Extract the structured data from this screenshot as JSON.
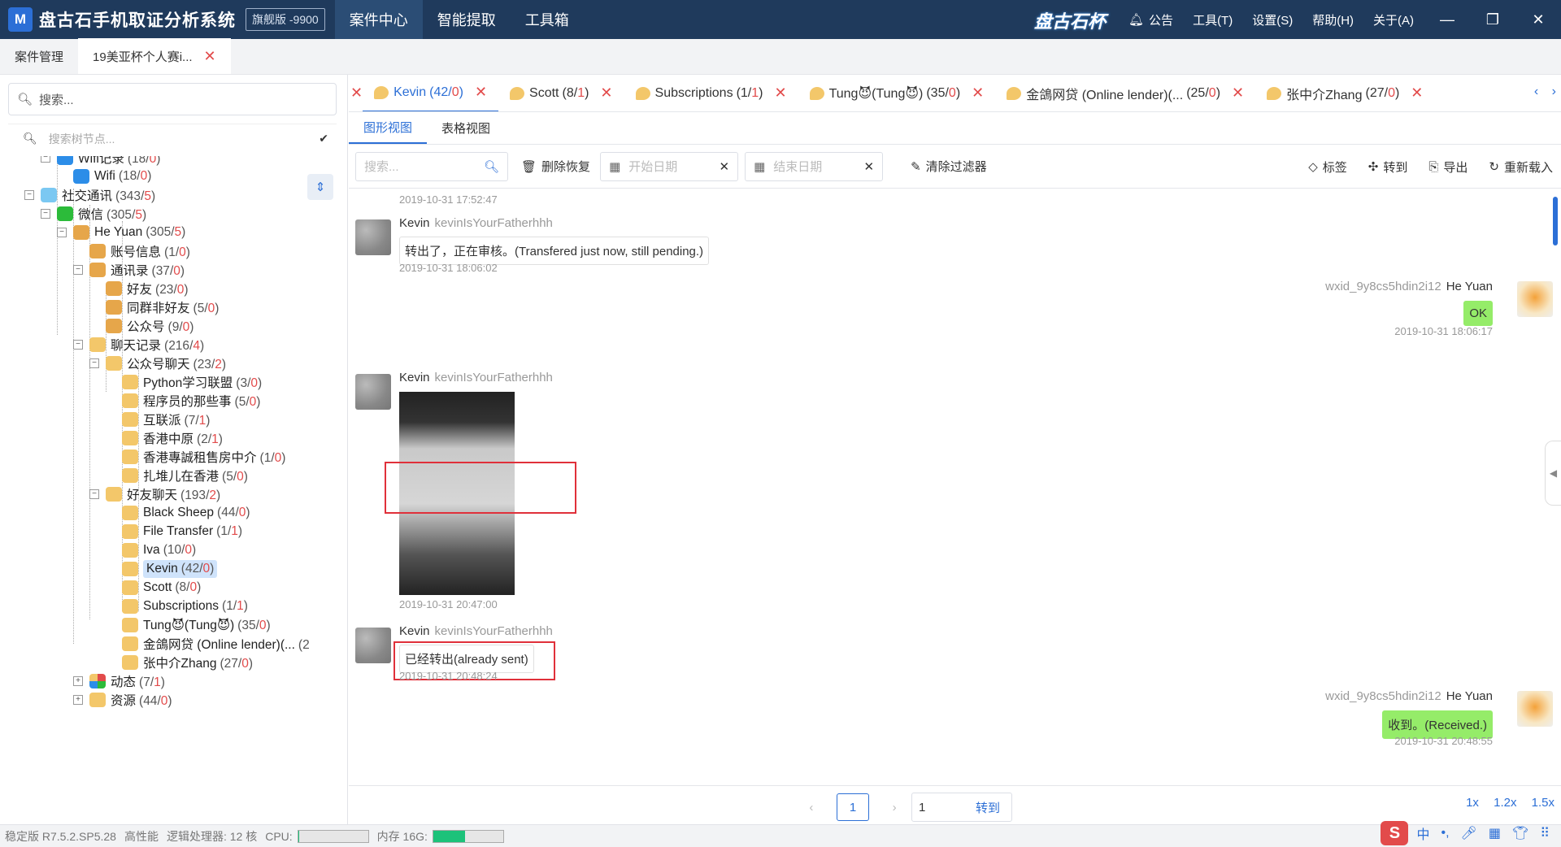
{
  "titlebar": {
    "logo": "M",
    "title": "盘古石手机取证分析系统",
    "edition": "旗舰版 -9900",
    "nav": [
      "案件中心",
      "智能提取",
      "工具箱"
    ],
    "brand": "盘古石杯",
    "menu": [
      "公告",
      "工具(T)",
      "设置(S)",
      "帮助(H)",
      "关于(A)"
    ]
  },
  "doctabs": [
    {
      "label": "案件管理"
    },
    {
      "label": "19美亚杯个人赛i..."
    }
  ],
  "left": {
    "search_placeholder": "搜索...",
    "tree_search_placeholder": "搜索树节点...",
    "tree": [
      {
        "label": "Wifi记录",
        "a": "18",
        "b": "0",
        "icon": "wifi-icon"
      },
      {
        "label": "Wifi",
        "a": "18",
        "b": "0",
        "icon": "wifi-icon"
      },
      {
        "label": "社交通讯",
        "a": "343",
        "b": "5",
        "icon": "social-icon"
      },
      {
        "label": "微信",
        "a": "305",
        "b": "5",
        "icon": "wechat-icon"
      },
      {
        "label": "He Yuan",
        "a": "305",
        "b": "5",
        "icon": "user-icon"
      },
      {
        "label": "账号信息",
        "a": "1",
        "b": "0",
        "icon": "user-icon"
      },
      {
        "label": "通讯录",
        "a": "37",
        "b": "0",
        "icon": "contacts-icon"
      },
      {
        "label": "好友",
        "a": "23",
        "b": "0",
        "icon": "contacts-icon"
      },
      {
        "label": "同群非好友",
        "a": "5",
        "b": "0",
        "icon": "contacts-icon"
      },
      {
        "label": "公众号",
        "a": "9",
        "b": "0",
        "icon": "contacts-icon"
      },
      {
        "label": "聊天记录",
        "a": "216",
        "b": "4",
        "icon": "chat-icon"
      },
      {
        "label": "公众号聊天",
        "a": "23",
        "b": "2",
        "icon": "chat-icon"
      },
      {
        "label": "Python学习联盟",
        "a": "3",
        "b": "0",
        "icon": "chat-icon"
      },
      {
        "label": "程序员的那些事",
        "a": "5",
        "b": "0",
        "icon": "chat-icon"
      },
      {
        "label": "互联派",
        "a": "7",
        "b": "1",
        "icon": "chat-icon"
      },
      {
        "label": "香港中原",
        "a": "2",
        "b": "1",
        "icon": "chat-icon"
      },
      {
        "label": "香港專誠租售房中介",
        "a": "1",
        "b": "0",
        "icon": "chat-icon"
      },
      {
        "label": "扎堆儿在香港",
        "a": "5",
        "b": "0",
        "icon": "chat-icon"
      },
      {
        "label": "好友聊天",
        "a": "193",
        "b": "2",
        "icon": "chat-icon"
      },
      {
        "label": "Black Sheep",
        "a": "44",
        "b": "0",
        "icon": "chat-icon"
      },
      {
        "label": "File Transfer",
        "a": "1",
        "b": "1",
        "icon": "chat-icon"
      },
      {
        "label": "Iva",
        "a": "10",
        "b": "0",
        "icon": "chat-icon"
      },
      {
        "label": "Kevin",
        "a": "42",
        "b": "0",
        "icon": "chat-icon"
      },
      {
        "label": "Scott",
        "a": "8",
        "b": "0",
        "icon": "chat-icon"
      },
      {
        "label": "Subscriptions",
        "a": "1",
        "b": "1",
        "icon": "chat-icon"
      },
      {
        "label": "Tung😈(Tung😈)",
        "a": "35",
        "b": "0",
        "icon": "chat-icon"
      },
      {
        "label": "金鴿网贷 (Online lender)(...",
        "a": "2",
        "b": "",
        "icon": "chat-icon"
      },
      {
        "label": "张中介Zhang",
        "a": "27",
        "b": "0",
        "icon": "chat-icon"
      },
      {
        "label": "动态",
        "a": "7",
        "b": "1",
        "icon": "moments-icon"
      },
      {
        "label": "资源",
        "a": "44",
        "b": "0",
        "icon": "chat-icon"
      }
    ]
  },
  "chattabs": [
    {
      "name": "Kevin",
      "a": "42",
      "b": "0"
    },
    {
      "name": "Scott",
      "a": "8",
      "b": "1"
    },
    {
      "name": "Subscriptions",
      "a": "1",
      "b": "1"
    },
    {
      "name": "Tung😈(Tung😈)",
      "a": "35",
      "b": "0"
    },
    {
      "name": "金鴿网贷 (Online lender)(...",
      "a": "25",
      "b": "0"
    },
    {
      "name": "张中介Zhang",
      "a": "27",
      "b": "0"
    }
  ],
  "viewtabs": [
    "图形视图",
    "表格视图"
  ],
  "toolbar": {
    "search_placeholder": "搜索...",
    "delete_restore": "删除恢复",
    "start_date": "开始日期",
    "end_date": "结束日期",
    "clear_filter": "清除过滤器",
    "tag": "标签",
    "goto": "转到",
    "export": "导出",
    "reload": "重新载入"
  },
  "messages": {
    "ts_top": "2019-10-31 17:52:47",
    "m1": {
      "sender": "Kevin",
      "id": "kevinIsYourFatherhhh",
      "text": "转出了，正在审核。(Transfered just now, still pending.)",
      "ts": "2019-10-31 18:06:02"
    },
    "m2": {
      "sender": "He Yuan",
      "id": "wxid_9y8cs5hdin2i12",
      "text": "OK",
      "ts": "2019-10-31 18:06:17"
    },
    "m3": {
      "sender": "Kevin",
      "id": "kevinIsYourFatherhhh",
      "ts": "2019-10-31 20:47:00"
    },
    "m4": {
      "sender": "Kevin",
      "id": "kevinIsYourFatherhhh",
      "text": "已经转出(already sent)",
      "ts": "2019-10-31 20:48:24"
    },
    "m5": {
      "sender": "He Yuan",
      "id": "wxid_9y8cs5hdin2i12",
      "text": "收到。(Received.)",
      "ts": "2019-10-31 20:48:55"
    }
  },
  "pager": {
    "current": "1",
    "goto_value": "1",
    "goto_label": "转到",
    "zooms": [
      "1x",
      "1.2x",
      "1.5x"
    ]
  },
  "statusbar": {
    "version": "稳定版 R7.5.2.SP5.28",
    "perf": "高性能",
    "cpu_cores": "逻辑处理器: 12 核",
    "cpu_label": "CPU:",
    "cpu_usage": 0.02,
    "mem_label": "内存 16G:",
    "mem_usage": 0.45
  },
  "ime": {
    "logo": "S",
    "lang": "中"
  },
  "colors": {
    "accent": "#2c6fd6",
    "titlebar": "#1f3a5c",
    "warn": "#e24b4b",
    "bubble_self": "#95ec69"
  }
}
